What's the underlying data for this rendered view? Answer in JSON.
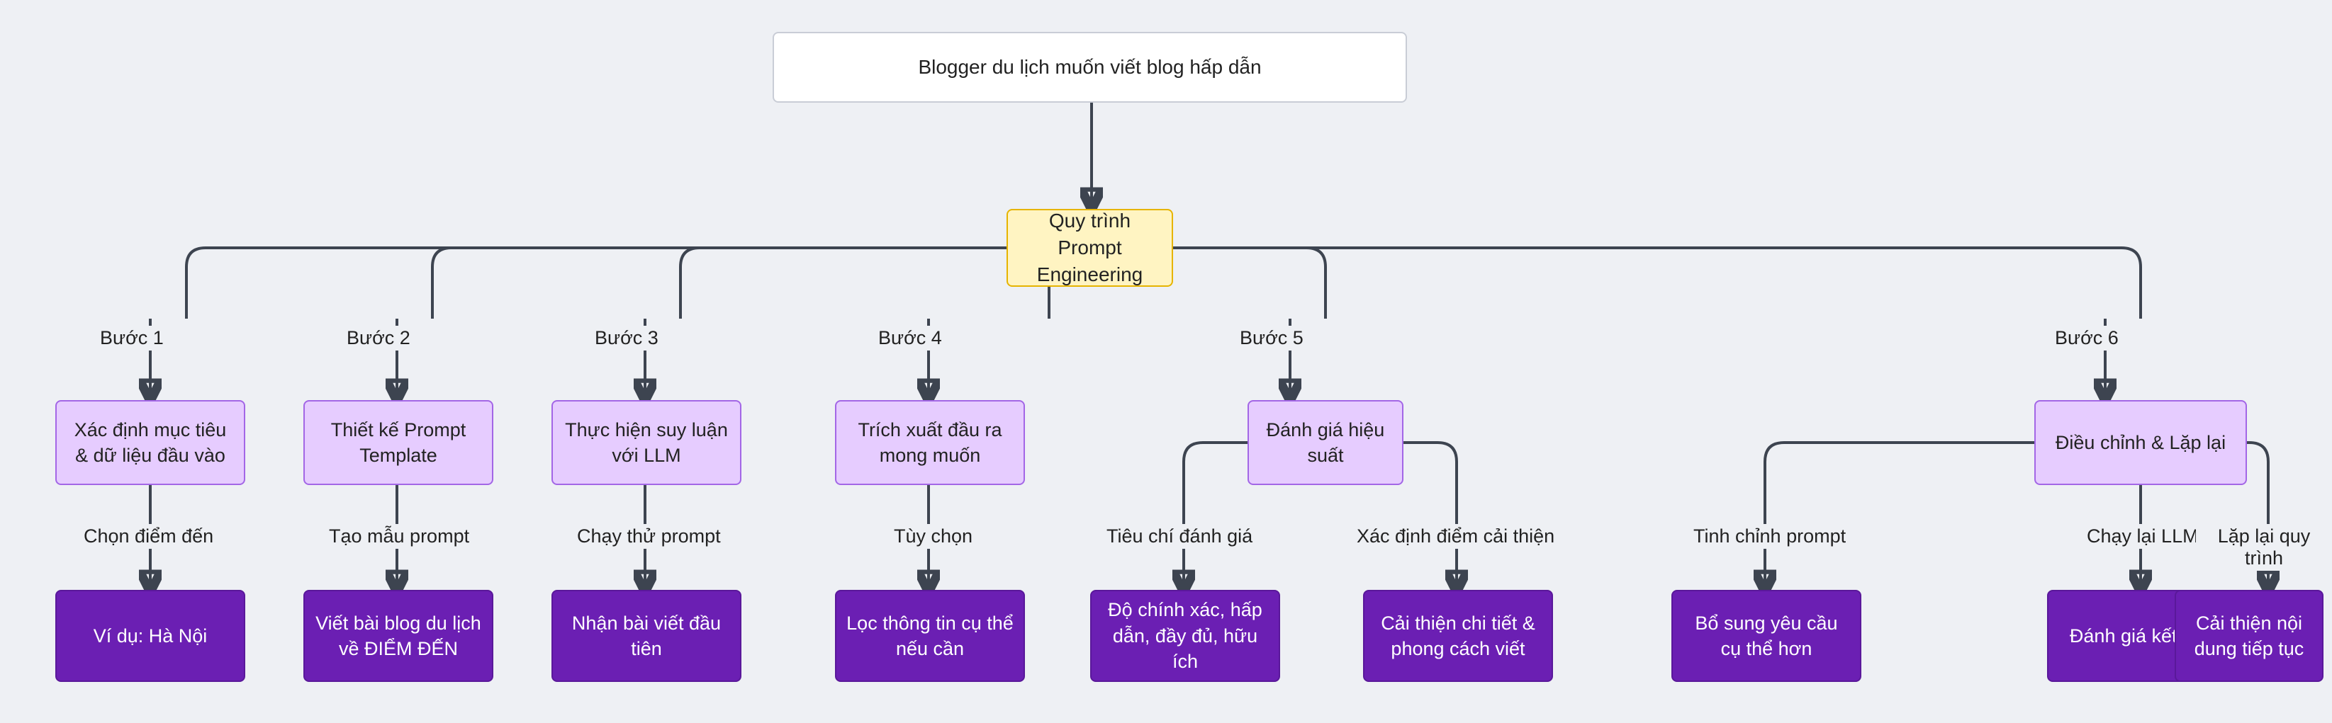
{
  "root": {
    "title": "Blogger du lịch muốn viết blog hấp dẫn"
  },
  "process": {
    "title": "Quy trình Prompt Engineering"
  },
  "steps": [
    {
      "label": "Bước 1",
      "box": "Xác định mục tiêu & dữ liệu đầu vào",
      "sub_label": "Chọn điểm đến",
      "leaf": "Ví dụ: Hà Nội"
    },
    {
      "label": "Bước 2",
      "box": "Thiết kế Prompt Template",
      "sub_label": "Tạo mẫu prompt",
      "leaf": "Viết bài blog du lịch về ĐIỂM ĐẾN"
    },
    {
      "label": "Bước 3",
      "box": "Thực hiện suy luận với LLM",
      "sub_label": "Chạy thử prompt",
      "leaf": "Nhận bài viết đầu tiên"
    },
    {
      "label": "Bước 4",
      "box": "Trích xuất đầu ra mong muốn",
      "sub_label": "Tùy chọn",
      "leaf": "Lọc thông tin cụ thể nếu cần"
    },
    {
      "label": "Bước 5",
      "box": "Đánh giá hiệu suất",
      "branches": [
        {
          "sub_label": "Tiêu chí đánh giá",
          "leaf": "Độ chính xác, hấp dẫn, đầy đủ, hữu ích"
        },
        {
          "sub_label": "Xác định điểm cải thiện",
          "leaf": "Cải thiện chi tiết & phong cách viết"
        }
      ]
    },
    {
      "label": "Bước 6",
      "box": "Điều chỉnh & Lặp lại",
      "branches": [
        {
          "sub_label": "Tinh chỉnh prompt",
          "leaf": "Bổ sung yêu cầu cụ thể hơn"
        },
        {
          "sub_label": "Chạy lại LLM",
          "leaf": "Đánh giá kết quả"
        },
        {
          "sub_label": "Lặp lại quy trình",
          "leaf": "Cải thiện nội dung tiếp tục"
        }
      ]
    }
  ]
}
